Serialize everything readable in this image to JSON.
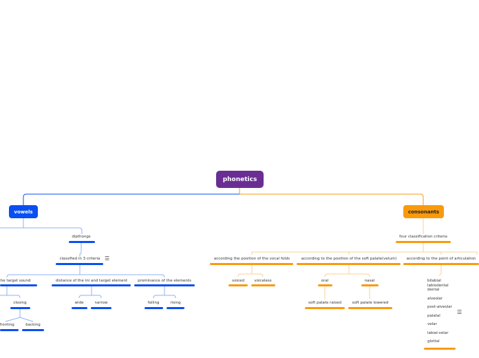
{
  "root": {
    "label": "phonetics",
    "color": "#6a2e93"
  },
  "colors": {
    "vowels": "#0a4ff2",
    "consonants": "#f99a0c",
    "connector_vowels_light": "#8fb0f5",
    "connector_consonants_light": "#fbd08f"
  },
  "vowels": {
    "label": "vowels",
    "diphthongs": {
      "label": "dipthongs",
      "criteria": {
        "label": "classified in 3 criteria",
        "has_notes": true,
        "items": [
          {
            "label": "of the target sound",
            "children": [
              {
                "label": "closing",
                "children": [
                  {
                    "label": "fronting"
                  },
                  {
                    "label": "backing"
                  }
                ]
              }
            ]
          },
          {
            "label": "distance of the ini and target element",
            "children": [
              {
                "label": "wide"
              },
              {
                "label": "narrow"
              }
            ]
          },
          {
            "label": "prominance of the elements",
            "children": [
              {
                "label": "falling"
              },
              {
                "label": "rising"
              }
            ]
          }
        ]
      }
    }
  },
  "consonants": {
    "label": "consonants",
    "criteria": {
      "label": "four classification criteria",
      "items": [
        {
          "label": "according the position of the vocal folds",
          "children": [
            {
              "label": "voiced"
            },
            {
              "label": "voiceless"
            }
          ]
        },
        {
          "label": "according to the position of the soft palate(velum)",
          "children": [
            {
              "label": "oral",
              "children": [
                {
                  "label": "soft palate raised"
                }
              ]
            },
            {
              "label": "nasal",
              "children": [
                {
                  "label": "soft palate lowered"
                }
              ]
            }
          ]
        },
        {
          "label": "according to the point of articulation",
          "has_notes": true,
          "places": [
            "bilabial",
            "labiodental",
            "dental",
            "alveolar",
            "post-alveolar",
            "palatal",
            "velar",
            "labial-velar",
            "glottal"
          ]
        }
      ]
    }
  }
}
